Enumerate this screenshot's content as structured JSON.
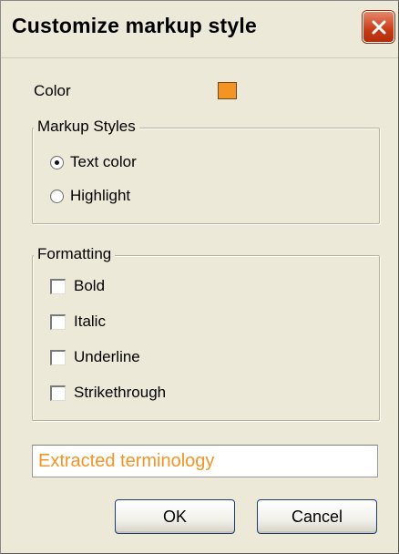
{
  "dialog": {
    "title": "Customize markup style",
    "close_icon": "close-x-icon"
  },
  "color": {
    "label": "Color",
    "swatch_hex": "#F39425"
  },
  "markup_styles": {
    "legend": "Markup Styles",
    "options": [
      {
        "label": "Text color",
        "selected": true
      },
      {
        "label": "Highlight",
        "selected": false
      }
    ]
  },
  "formatting": {
    "legend": "Formatting",
    "options": [
      {
        "label": "Bold",
        "checked": false
      },
      {
        "label": "Italic",
        "checked": false
      },
      {
        "label": "Underline",
        "checked": false
      },
      {
        "label": "Strikethrough",
        "checked": false
      }
    ]
  },
  "preview": {
    "value": "Extracted terminology",
    "text_color": "#F39425"
  },
  "buttons": {
    "ok_label": "OK",
    "cancel_label": "Cancel"
  }
}
